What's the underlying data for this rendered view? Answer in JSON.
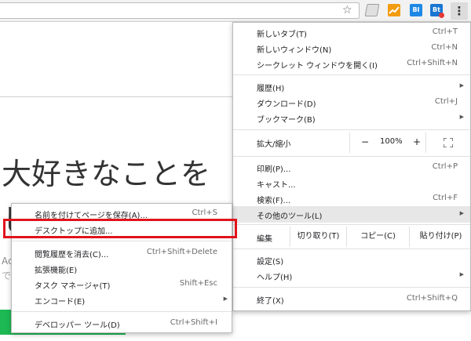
{
  "toolbar": {
    "star_icon": "star-icon",
    "ext3_label": "BI",
    "ext4_label": "Bt",
    "menu_icon": "⋮",
    "colors": {
      "ext2": "#f39c12",
      "ext3": "#1e88e5",
      "ext4": "#1976d2"
    }
  },
  "page": {
    "headline": "大好きなことを",
    "headline2": "し",
    "faint1": "Ac",
    "faint2": "で",
    "accent": "#1db954"
  },
  "main_menu": {
    "new_tab": {
      "label": "新しいタブ(T)",
      "shortcut": "Ctrl+T"
    },
    "new_window": {
      "label": "新しいウィンドウ(N)",
      "shortcut": "Ctrl+N"
    },
    "incognito": {
      "label": "シークレット ウィンドウを開く(I)",
      "shortcut": "Ctrl+Shift+N"
    },
    "history": {
      "label": "履歴(H)"
    },
    "downloads": {
      "label": "ダウンロード(D)",
      "shortcut": "Ctrl+J"
    },
    "bookmarks": {
      "label": "ブックマーク(B)"
    },
    "zoom": {
      "label": "拡大/縮小",
      "minus": "−",
      "value": "100%",
      "plus": "+"
    },
    "print": {
      "label": "印刷(P)...",
      "shortcut": "Ctrl+P"
    },
    "cast": {
      "label": "キャスト..."
    },
    "find": {
      "label": "検索(F)...",
      "shortcut": "Ctrl+F"
    },
    "more_tools": {
      "label": "その他のツール(L)"
    },
    "edit": {
      "label": "編集",
      "cut": "切り取り(T)",
      "copy": "コピー(C)",
      "paste": "貼り付け(P)"
    },
    "settings": {
      "label": "設定(S)"
    },
    "help": {
      "label": "ヘルプ(H)"
    },
    "exit": {
      "label": "終了(X)",
      "shortcut": "Ctrl+Shift+Q"
    }
  },
  "sub_menu": {
    "save_as": {
      "label": "名前を付けてページを保存(A)...",
      "shortcut": "Ctrl+S"
    },
    "add_to_desktop": {
      "label": "デスクトップに追加..."
    },
    "clear_data": {
      "label": "閲覧履歴を消去(C)...",
      "shortcut": "Ctrl+Shift+Delete"
    },
    "extensions": {
      "label": "拡張機能(E)"
    },
    "task_manager": {
      "label": "タスク マネージャ(T)",
      "shortcut": "Shift+Esc"
    },
    "encoding": {
      "label": "エンコード(E)"
    },
    "devtools": {
      "label": "デベロッパー ツール(D)",
      "shortcut": "Ctrl+Shift+I"
    }
  },
  "annotation": {
    "color": "#e0141c"
  }
}
